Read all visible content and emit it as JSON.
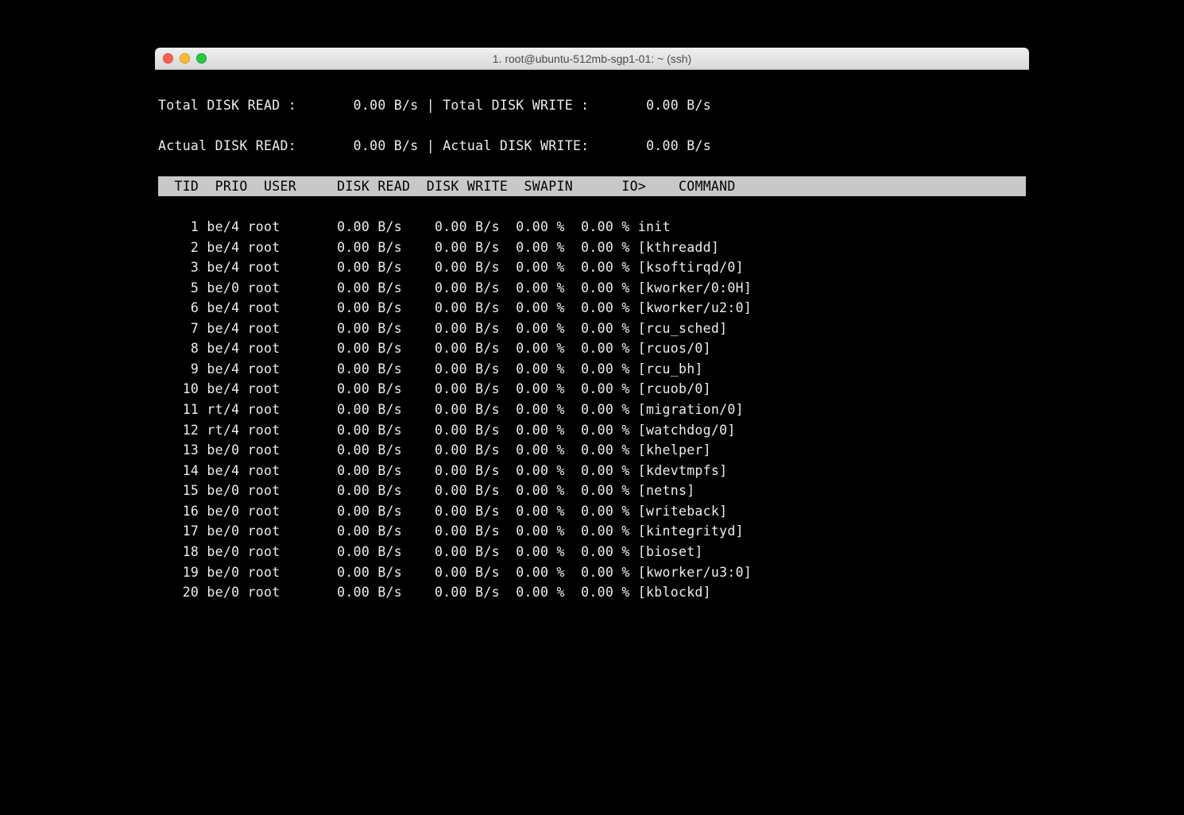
{
  "window_title": "1. root@ubuntu-512mb-sgp1-01: ~ (ssh)",
  "summary": {
    "total_read_label": "Total DISK READ :",
    "total_read_value": "0.00 B/s",
    "total_write_label": "Total DISK WRITE :",
    "total_write_value": "0.00 B/s",
    "actual_read_label": "Actual DISK READ:",
    "actual_read_value": "0.00 B/s",
    "actual_write_label": "Actual DISK WRITE:",
    "actual_write_value": "0.00 B/s",
    "separator": "|"
  },
  "columns": {
    "tid": "TID",
    "prio": "PRIO",
    "user": "USER",
    "disk_read": "DISK READ",
    "disk_write": "DISK WRITE",
    "swapin": "SWAPIN",
    "io": "IO>",
    "command": "COMMAND"
  },
  "processes": [
    {
      "tid": "1",
      "prio": "be/4",
      "user": "root",
      "disk_read": "0.00 B/s",
      "disk_write": "0.00 B/s",
      "swapin": "0.00 %",
      "io": "0.00 %",
      "command": "init"
    },
    {
      "tid": "2",
      "prio": "be/4",
      "user": "root",
      "disk_read": "0.00 B/s",
      "disk_write": "0.00 B/s",
      "swapin": "0.00 %",
      "io": "0.00 %",
      "command": "[kthreadd]"
    },
    {
      "tid": "3",
      "prio": "be/4",
      "user": "root",
      "disk_read": "0.00 B/s",
      "disk_write": "0.00 B/s",
      "swapin": "0.00 %",
      "io": "0.00 %",
      "command": "[ksoftirqd/0]"
    },
    {
      "tid": "5",
      "prio": "be/0",
      "user": "root",
      "disk_read": "0.00 B/s",
      "disk_write": "0.00 B/s",
      "swapin": "0.00 %",
      "io": "0.00 %",
      "command": "[kworker/0:0H]"
    },
    {
      "tid": "6",
      "prio": "be/4",
      "user": "root",
      "disk_read": "0.00 B/s",
      "disk_write": "0.00 B/s",
      "swapin": "0.00 %",
      "io": "0.00 %",
      "command": "[kworker/u2:0]"
    },
    {
      "tid": "7",
      "prio": "be/4",
      "user": "root",
      "disk_read": "0.00 B/s",
      "disk_write": "0.00 B/s",
      "swapin": "0.00 %",
      "io": "0.00 %",
      "command": "[rcu_sched]"
    },
    {
      "tid": "8",
      "prio": "be/4",
      "user": "root",
      "disk_read": "0.00 B/s",
      "disk_write": "0.00 B/s",
      "swapin": "0.00 %",
      "io": "0.00 %",
      "command": "[rcuos/0]"
    },
    {
      "tid": "9",
      "prio": "be/4",
      "user": "root",
      "disk_read": "0.00 B/s",
      "disk_write": "0.00 B/s",
      "swapin": "0.00 %",
      "io": "0.00 %",
      "command": "[rcu_bh]"
    },
    {
      "tid": "10",
      "prio": "be/4",
      "user": "root",
      "disk_read": "0.00 B/s",
      "disk_write": "0.00 B/s",
      "swapin": "0.00 %",
      "io": "0.00 %",
      "command": "[rcuob/0]"
    },
    {
      "tid": "11",
      "prio": "rt/4",
      "user": "root",
      "disk_read": "0.00 B/s",
      "disk_write": "0.00 B/s",
      "swapin": "0.00 %",
      "io": "0.00 %",
      "command": "[migration/0]"
    },
    {
      "tid": "12",
      "prio": "rt/4",
      "user": "root",
      "disk_read": "0.00 B/s",
      "disk_write": "0.00 B/s",
      "swapin": "0.00 %",
      "io": "0.00 %",
      "command": "[watchdog/0]"
    },
    {
      "tid": "13",
      "prio": "be/0",
      "user": "root",
      "disk_read": "0.00 B/s",
      "disk_write": "0.00 B/s",
      "swapin": "0.00 %",
      "io": "0.00 %",
      "command": "[khelper]"
    },
    {
      "tid": "14",
      "prio": "be/4",
      "user": "root",
      "disk_read": "0.00 B/s",
      "disk_write": "0.00 B/s",
      "swapin": "0.00 %",
      "io": "0.00 %",
      "command": "[kdevtmpfs]"
    },
    {
      "tid": "15",
      "prio": "be/0",
      "user": "root",
      "disk_read": "0.00 B/s",
      "disk_write": "0.00 B/s",
      "swapin": "0.00 %",
      "io": "0.00 %",
      "command": "[netns]"
    },
    {
      "tid": "16",
      "prio": "be/0",
      "user": "root",
      "disk_read": "0.00 B/s",
      "disk_write": "0.00 B/s",
      "swapin": "0.00 %",
      "io": "0.00 %",
      "command": "[writeback]"
    },
    {
      "tid": "17",
      "prio": "be/0",
      "user": "root",
      "disk_read": "0.00 B/s",
      "disk_write": "0.00 B/s",
      "swapin": "0.00 %",
      "io": "0.00 %",
      "command": "[kintegrityd]"
    },
    {
      "tid": "18",
      "prio": "be/0",
      "user": "root",
      "disk_read": "0.00 B/s",
      "disk_write": "0.00 B/s",
      "swapin": "0.00 %",
      "io": "0.00 %",
      "command": "[bioset]"
    },
    {
      "tid": "19",
      "prio": "be/0",
      "user": "root",
      "disk_read": "0.00 B/s",
      "disk_write": "0.00 B/s",
      "swapin": "0.00 %",
      "io": "0.00 %",
      "command": "[kworker/u3:0]"
    },
    {
      "tid": "20",
      "prio": "be/0",
      "user": "root",
      "disk_read": "0.00 B/s",
      "disk_write": "0.00 B/s",
      "swapin": "0.00 %",
      "io": "0.00 %",
      "command": "[kblockd]"
    }
  ]
}
